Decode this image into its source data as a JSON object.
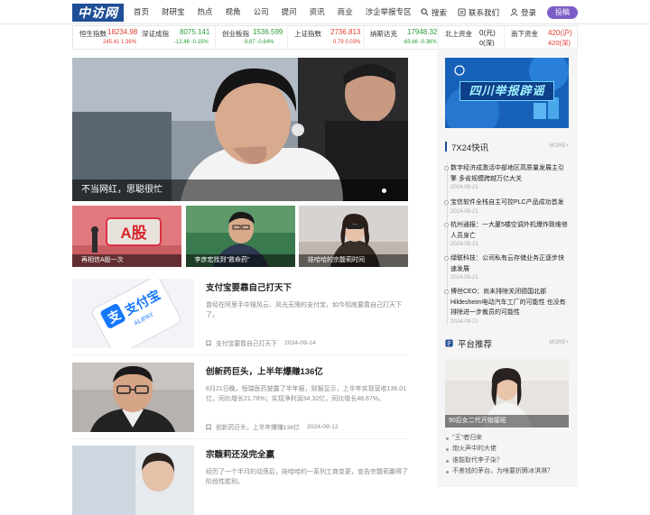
{
  "header": {
    "logo_text": "中访网",
    "nav": [
      "首页",
      "财研宝",
      "热点",
      "视角",
      "公司",
      "提问",
      "资讯",
      "商业",
      "涉企举报专区"
    ],
    "search_label": "搜索",
    "contact_label": "联系我们",
    "login_label": "登录",
    "submit_label": "投稿"
  },
  "ticker": [
    {
      "name": "恒生指数",
      "value": "18234.98",
      "change": "245.41",
      "pct": "1.36%",
      "dir": "up"
    },
    {
      "name": "深证成指",
      "value": "8075.141",
      "change": "-12.46",
      "pct": "-0.15%",
      "dir": "down"
    },
    {
      "name": "创业板指",
      "value": "1536.599",
      "change": "-9.87",
      "pct": "-0.64%",
      "dir": "down"
    },
    {
      "name": "上证指数",
      "value": "2736.813",
      "change": "0.79",
      "pct": "0.03%",
      "dir": "up"
    },
    {
      "name": "纳斯达克",
      "value": "17948.32",
      "change": "-65.66",
      "pct": "-0.36%",
      "dir": "down"
    },
    {
      "name": "北上资金",
      "value": "0(元)",
      "change": "",
      "pct": "0(深)",
      "dir": "flat"
    },
    {
      "name": "南下资金",
      "value": "420(沪)",
      "change": "",
      "pct": "420(深)",
      "dir": "up"
    }
  ],
  "hero": {
    "caption": "不当网红，思聪很忙"
  },
  "thumbs": [
    {
      "caption": "再相信A股一次",
      "badge": "A股"
    },
    {
      "caption": "李彦宏找到\"救命药\""
    },
    {
      "caption": "娃哈哈的宗馥莉时间"
    }
  ],
  "articles": [
    {
      "title": "支付宝要靠自己打天下",
      "summary": "曾经在阿里手中搜风云、风光无限的支付宝，如今彻底要靠自己打天下了。",
      "tag": "支付宝要靠自己打天下",
      "date": "2024-09-14",
      "logo_text": "支付宝",
      "logo_sub": "ALIPAY"
    },
    {
      "title": "创新药巨头，上半年爆赚136亿",
      "summary": "8月21日晚，恒瑞医药披露了半年报，财报显示，上半年实现营收136.01亿，同比增长21.78%；实现净利润34.32亿，同比增长48.67%。",
      "tag": "创新药巨头，上半年爆赚136亿",
      "date": "2024-09-12"
    },
    {
      "title": "宗馥莉还没完全赢",
      "summary": "经历了一个半月的动荡后，娃哈哈的一系列工商变更，宣告宗馥莉赢得了阶段性胜利。",
      "tag": "",
      "date": ""
    }
  ],
  "sidebar": {
    "banner_text": "四川举报辟谣",
    "flash_title": "7X24快讯",
    "flash_more": "MORE+",
    "flash": [
      {
        "text": "数字经济成激活中部地区高质量发展主引擎 多省规模跨越万亿大关",
        "date": "2024-09-21"
      },
      {
        "text": "宝信软件全栈自主可控PLC产品成功首发",
        "date": "2024-09-21"
      },
      {
        "text": "杭州通报：一大厦5楼空调外机爆炸致维修人员身亡",
        "date": "2024-09-21"
      },
      {
        "text": "绿联科技：公司私有云存储业务正逐步快速发展",
        "date": "2024-09-21"
      },
      {
        "text": "博世CEO：尚未排除关闭德国北部Hildesheim电动汽车工厂的可能性 也没有排除进一步裁员的可能性",
        "date": "2024-09-21"
      }
    ],
    "promo_title": "平台推荐",
    "promo_more": "MORE+",
    "promo_caption": "90后女二代开始接班",
    "promo_list": [
      "\"王\"者归来",
      "炮火声中的大佬",
      "谁能取代李子柒？",
      "不差钱的茅台，为啥要折腾冰淇淋？"
    ]
  }
}
